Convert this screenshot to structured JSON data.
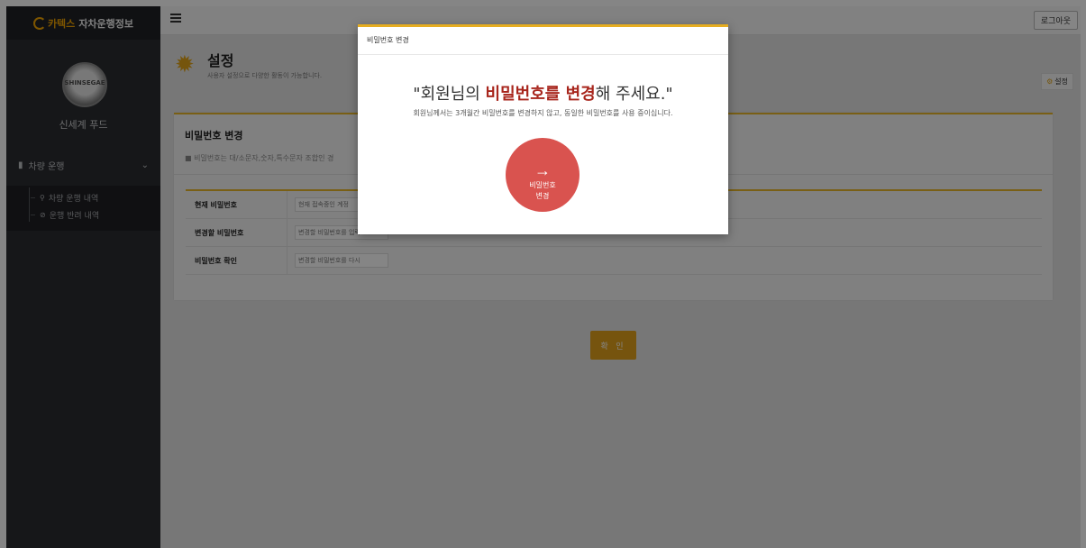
{
  "sidebar": {
    "brand_prefix": "카텍스",
    "brand_name": "자차운행정보",
    "avatar_text": "SHINSEGAE",
    "company": "신세계 푸드",
    "menu_group": "차량 운행",
    "items": [
      {
        "label": "차량 운행 내역",
        "icon": "pin-icon"
      },
      {
        "label": "운행 반려 내역",
        "icon": "ban-icon"
      }
    ]
  },
  "topbar": {
    "logout_label": "로그아웃"
  },
  "page": {
    "title": "설정",
    "subtitle": "사용자 설정으로 다양한 활동이 가능합니다.",
    "settings_link": "설정"
  },
  "card": {
    "title": "비밀번호 변경",
    "note": "비밀번호는 대/소문자,숫자,특수문자 조합인 경",
    "rows": [
      {
        "label": "현재 비밀번호",
        "placeholder": "현재 접속중인 계정"
      },
      {
        "label": "변경할 비밀번호",
        "placeholder": "변경할 비밀번호를 입력"
      },
      {
        "label": "비밀번호 확인",
        "placeholder": "변경할 비밀번호를 다시"
      }
    ],
    "confirm_label": "확 인"
  },
  "modal": {
    "header": "비밀번호 변경",
    "headline_prefix": "\"회원님의 ",
    "headline_highlight": "비밀번호를 변경",
    "headline_suffix": "해 주세요.\"",
    "description": "회원님께서는 3개월간 비밀번호를 변경하지 않고, 동일한 비밀번호를 사용 중이십니다.",
    "button_arrow": "→",
    "button_line1": "비밀번호",
    "button_line2": "변경"
  },
  "colors": {
    "accent": "#e6ad20",
    "danger": "#d9534f",
    "highlight": "#a8261d"
  }
}
